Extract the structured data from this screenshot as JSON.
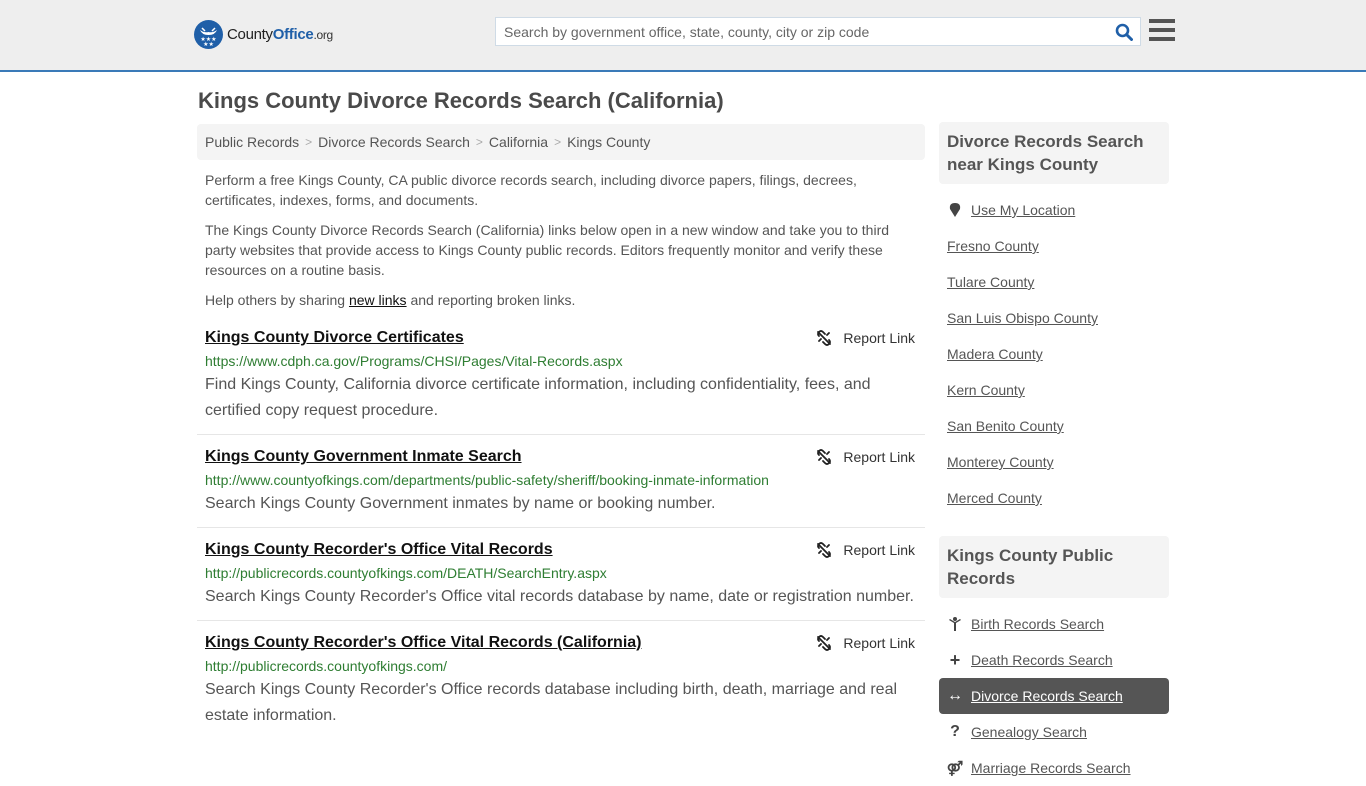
{
  "header": {
    "logo": {
      "part1": "County",
      "part2": "Office",
      "part3": ".org"
    },
    "search_placeholder": "Search by government office, state, county, city or zip code",
    "accent_color": "#1f5fa8"
  },
  "page": {
    "title": "Kings County Divorce Records Search (California)"
  },
  "breadcrumb": [
    "Public Records",
    "Divorce Records Search",
    "California",
    "Kings County"
  ],
  "intro": {
    "p1": "Perform a free Kings County, CA public divorce records search, including divorce papers, filings, decrees, certificates, indexes, forms, and documents.",
    "p2": "The Kings County Divorce Records Search (California) links below open in a new window and take you to third party websites that provide access to Kings County public records. Editors frequently monitor and verify these resources on a routine basis.",
    "p3_before": "Help others by sharing ",
    "p3_link": "new links",
    "p3_after": " and reporting broken links."
  },
  "results": [
    {
      "title": "Kings County Divorce Certificates",
      "url": "https://www.cdph.ca.gov/Programs/CHSI/Pages/Vital-Records.aspx",
      "desc": "Find Kings County, California divorce certificate information, including confidentiality, fees, and certified copy request procedure.",
      "report": "Report Link"
    },
    {
      "title": "Kings County Government Inmate Search",
      "url": "http://www.countyofkings.com/departments/public-safety/sheriff/booking-inmate-information",
      "desc": "Search Kings County Government inmates by name or booking number.",
      "report": "Report Link"
    },
    {
      "title": "Kings County Recorder's Office Vital Records",
      "url": "http://publicrecords.countyofkings.com/DEATH/SearchEntry.aspx",
      "desc": "Search Kings County Recorder's Office vital records database by name, date or registration number.",
      "report": "Report Link"
    },
    {
      "title": "Kings County Recorder's Office Vital Records (California)",
      "url": "http://publicrecords.countyofkings.com/",
      "desc": "Search Kings County Recorder's Office records database including birth, death, marriage and real estate information.",
      "report": "Report Link"
    }
  ],
  "sidebar": {
    "nearby": {
      "heading": "Divorce Records Search near Kings County",
      "use_location": "Use My Location",
      "counties": [
        "Fresno County",
        "Tulare County",
        "San Luis Obispo County",
        "Madera County",
        "Kern County",
        "San Benito County",
        "Monterey County",
        "Merced County"
      ]
    },
    "public_records": {
      "heading": "Kings County Public Records",
      "items": [
        {
          "label": "Birth Records Search",
          "icon": "child-icon"
        },
        {
          "label": "Death Records Search",
          "icon": "plus-icon"
        },
        {
          "label": "Divorce Records Search",
          "icon": "arrows-horizontal-icon",
          "active": true
        },
        {
          "label": "Genealogy Search",
          "icon": "question-icon"
        },
        {
          "label": "Marriage Records Search",
          "icon": "marriage-icon"
        }
      ]
    }
  }
}
